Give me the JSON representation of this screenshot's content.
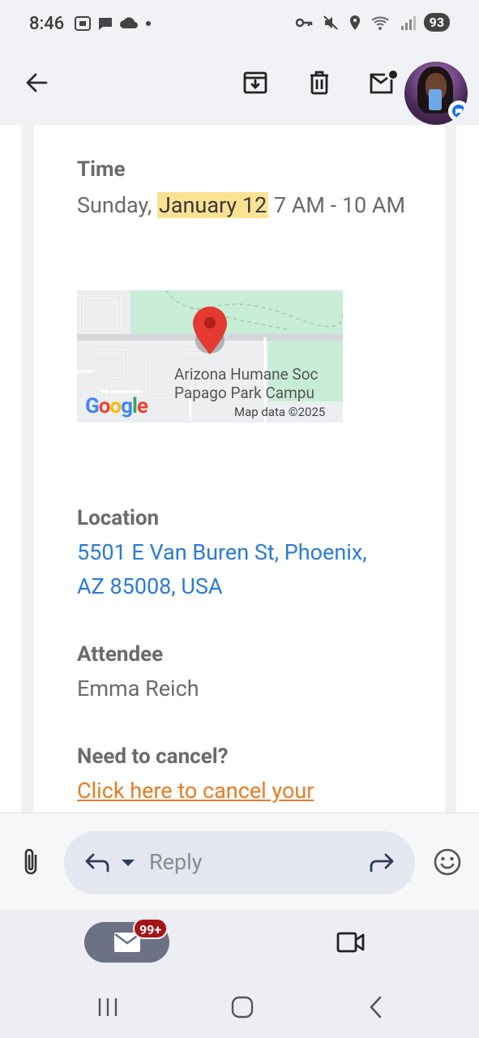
{
  "status_bar": {
    "time": "8:46",
    "battery": "93"
  },
  "email": {
    "time_label": "Time",
    "time_prefix": "Sunday,",
    "time_highlight": "January 12",
    "time_suffix": "7 AM - 10 AM",
    "map": {
      "place_line1": "Arizona Humane Soc",
      "place_line2": "Papago Park Campu",
      "logo": "Google",
      "credit": "Map data ©2025"
    },
    "location_label": "Location",
    "location_line1": "5501 E Van Buren St, Phoenix,",
    "location_line2": "AZ 85008, USA",
    "attendee_label": "Attendee",
    "attendee_name": "Emma Reich",
    "cancel_label": "Need to cancel?",
    "cancel_link": "Click here to cancel your"
  },
  "reply_bar": {
    "placeholder": "Reply"
  },
  "bottom_nav": {
    "mail_badge": "99+"
  },
  "colors": {
    "link_blue": "#2b7bd6",
    "link_orange": "#e87b23",
    "highlight": "#fde293",
    "badge_red": "#a51414"
  }
}
